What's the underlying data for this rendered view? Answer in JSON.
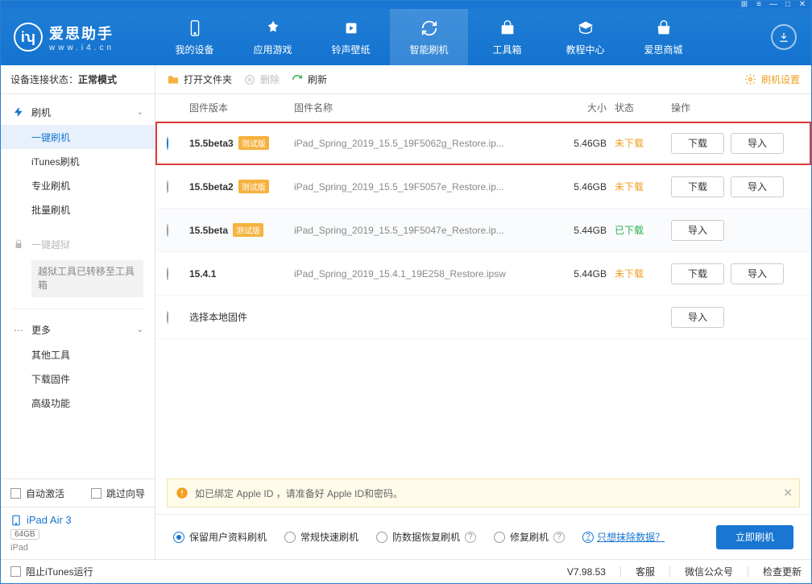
{
  "app": {
    "name": "爱思助手",
    "url": "www.i4.cn"
  },
  "window_icons": [
    "grid",
    "menu",
    "min",
    "max",
    "close"
  ],
  "nav": [
    {
      "id": "device",
      "label": "我的设备"
    },
    {
      "id": "apps",
      "label": "应用游戏"
    },
    {
      "id": "ringtones",
      "label": "铃声壁纸"
    },
    {
      "id": "flash",
      "label": "智能刷机",
      "active": true
    },
    {
      "id": "tools",
      "label": "工具箱"
    },
    {
      "id": "tutorials",
      "label": "教程中心"
    },
    {
      "id": "store",
      "label": "爱思商城"
    }
  ],
  "connection": {
    "label": "设备连接状态：",
    "value": "正常模式"
  },
  "sidebar": {
    "flash": {
      "title": "刷机",
      "items": [
        "一键刷机",
        "iTunes刷机",
        "专业刷机",
        "批量刷机"
      ]
    },
    "jailbreak": {
      "title": "一键越狱",
      "note": "越狱工具已转移至工具箱"
    },
    "more": {
      "title": "更多",
      "items": [
        "其他工具",
        "下载固件",
        "高级功能"
      ]
    },
    "auto_activate": "自动激活",
    "skip_guide": "跳过向导"
  },
  "device": {
    "name": "iPad Air 3",
    "capacity": "64GB",
    "type": "iPad"
  },
  "toolbar": {
    "open": "打开文件夹",
    "delete": "删除",
    "refresh": "刷新",
    "settings": "刷机设置"
  },
  "columns": {
    "version": "固件版本",
    "name": "固件名称",
    "size": "大小",
    "status": "状态",
    "action": "操作"
  },
  "labels": {
    "download": "下载",
    "import": "导入",
    "local": "选择本地固件",
    "beta_tag": "测试版"
  },
  "firmware": [
    {
      "selected": true,
      "hl": true,
      "version": "15.5beta3",
      "beta": true,
      "name": "iPad_Spring_2019_15.5_19F5062g_Restore.ip...",
      "size": "5.46GB",
      "status": "未下载",
      "status_type": "no",
      "has_dl": true
    },
    {
      "selected": false,
      "version": "15.5beta2",
      "beta": true,
      "name": "iPad_Spring_2019_15.5_19F5057e_Restore.ip...",
      "size": "5.46GB",
      "status": "未下载",
      "status_type": "no",
      "has_dl": true
    },
    {
      "selected": false,
      "alt": true,
      "version": "15.5beta",
      "beta": true,
      "name": "iPad_Spring_2019_15.5_19F5047e_Restore.ip...",
      "size": "5.44GB",
      "status": "已下载",
      "status_type": "yes",
      "has_dl": false
    },
    {
      "selected": false,
      "version": "15.4.1",
      "beta": false,
      "name": "iPad_Spring_2019_15.4.1_19E258_Restore.ipsw",
      "size": "5.44GB",
      "status": "未下载",
      "status_type": "no",
      "has_dl": true
    }
  ],
  "tip": "如已绑定 Apple ID ，请准备好 Apple ID和密码。",
  "options": [
    "保留用户资料刷机",
    "常规快速刷机",
    "防数据恢复刷机",
    "修复刷机"
  ],
  "erase_link": "只想抹除数据？",
  "flash_now": "立即刷机",
  "footer": {
    "block": "阻止iTunes运行",
    "version": "V7.98.53",
    "support": "客服",
    "wechat": "微信公众号",
    "update": "检查更新"
  }
}
